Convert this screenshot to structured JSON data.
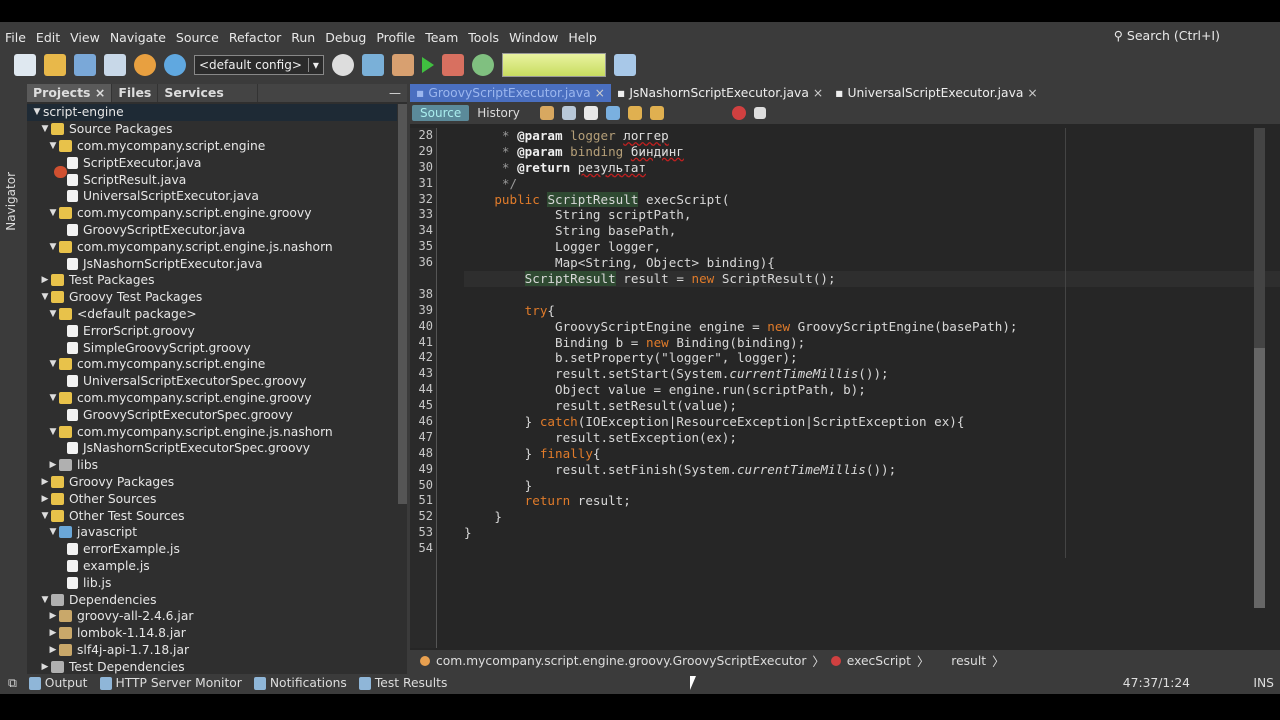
{
  "menu": [
    "File",
    "Edit",
    "View",
    "Navigate",
    "Source",
    "Refactor",
    "Run",
    "Debug",
    "Profile",
    "Team",
    "Tools",
    "Window",
    "Help"
  ],
  "search_placeholder": "Search (Ctrl+I)",
  "toolbar": {
    "config": "<default config>"
  },
  "navigator_label": "Navigator",
  "project_tabs": [
    "Projects",
    "Files",
    "Services"
  ],
  "tree": [
    {
      "label": "script-engine",
      "depth": 0,
      "arrow": "▼",
      "icon": "proj",
      "selected": true
    },
    {
      "label": "Source Packages",
      "depth": 1,
      "arrow": "▼",
      "icon": "pkg"
    },
    {
      "label": "com.mycompany.script.engine",
      "depth": 2,
      "arrow": "▼",
      "icon": "pkg"
    },
    {
      "label": "ScriptExecutor.java",
      "depth": 3,
      "arrow": "",
      "icon": "file"
    },
    {
      "label": "ScriptResult.java",
      "depth": 3,
      "arrow": "",
      "icon": "file"
    },
    {
      "label": "UniversalScriptExecutor.java",
      "depth": 3,
      "arrow": "",
      "icon": "file"
    },
    {
      "label": "com.mycompany.script.engine.groovy",
      "depth": 2,
      "arrow": "▼",
      "icon": "pkg"
    },
    {
      "label": "GroovyScriptExecutor.java",
      "depth": 3,
      "arrow": "",
      "icon": "file"
    },
    {
      "label": "com.mycompany.script.engine.js.nashorn",
      "depth": 2,
      "arrow": "▼",
      "icon": "pkg"
    },
    {
      "label": "JsNashornScriptExecutor.java",
      "depth": 3,
      "arrow": "",
      "icon": "file"
    },
    {
      "label": "Test Packages",
      "depth": 1,
      "arrow": "▶",
      "icon": "pkg"
    },
    {
      "label": "Groovy Test Packages",
      "depth": 1,
      "arrow": "▼",
      "icon": "pkg"
    },
    {
      "label": "<default package>",
      "depth": 2,
      "arrow": "▼",
      "icon": "pkg"
    },
    {
      "label": "ErrorScript.groovy",
      "depth": 3,
      "arrow": "",
      "icon": "file"
    },
    {
      "label": "SimpleGroovyScript.groovy",
      "depth": 3,
      "arrow": "",
      "icon": "file"
    },
    {
      "label": "com.mycompany.script.engine",
      "depth": 2,
      "arrow": "▼",
      "icon": "pkg"
    },
    {
      "label": "UniversalScriptExecutorSpec.groovy",
      "depth": 3,
      "arrow": "",
      "icon": "file"
    },
    {
      "label": "com.mycompany.script.engine.groovy",
      "depth": 2,
      "arrow": "▼",
      "icon": "pkg"
    },
    {
      "label": "GroovyScriptExecutorSpec.groovy",
      "depth": 3,
      "arrow": "",
      "icon": "file"
    },
    {
      "label": "com.mycompany.script.engine.js.nashorn",
      "depth": 2,
      "arrow": "▼",
      "icon": "pkg"
    },
    {
      "label": "JsNashornScriptExecutorSpec.groovy",
      "depth": 3,
      "arrow": "",
      "icon": "file"
    },
    {
      "label": "libs",
      "depth": 2,
      "arrow": "▶",
      "icon": "lib"
    },
    {
      "label": "Groovy Packages",
      "depth": 1,
      "arrow": "▶",
      "icon": "pkg"
    },
    {
      "label": "Other Sources",
      "depth": 1,
      "arrow": "▶",
      "icon": "pkg"
    },
    {
      "label": "Other Test Sources",
      "depth": 1,
      "arrow": "▼",
      "icon": "pkg"
    },
    {
      "label": "javascript",
      "depth": 2,
      "arrow": "▼",
      "icon": "folder"
    },
    {
      "label": "errorExample.js",
      "depth": 3,
      "arrow": "",
      "icon": "file"
    },
    {
      "label": "example.js",
      "depth": 3,
      "arrow": "",
      "icon": "file"
    },
    {
      "label": "lib.js",
      "depth": 3,
      "arrow": "",
      "icon": "file"
    },
    {
      "label": "Dependencies",
      "depth": 1,
      "arrow": "▼",
      "icon": "lib"
    },
    {
      "label": "groovy-all-2.4.6.jar",
      "depth": 2,
      "arrow": "▶",
      "icon": "jar"
    },
    {
      "label": "lombok-1.14.8.jar",
      "depth": 2,
      "arrow": "▶",
      "icon": "jar"
    },
    {
      "label": "slf4j-api-1.7.18.jar",
      "depth": 2,
      "arrow": "▶",
      "icon": "jar"
    },
    {
      "label": "Test Dependencies",
      "depth": 1,
      "arrow": "▶",
      "icon": "lib"
    }
  ],
  "editor_tabs": [
    {
      "label": "GroovyScriptExecutor.java",
      "active": true
    },
    {
      "label": "JsNashornScriptExecutor.java"
    },
    {
      "label": "UniversalScriptExecutor.java"
    }
  ],
  "editor_toolbar": {
    "source": "Source",
    "history": "History"
  },
  "code": [
    {
      "n": "28",
      "s": [
        [
          "     * ",
          "cm"
        ],
        [
          "@param",
          "tag"
        ],
        [
          " logger ",
          "prm"
        ],
        [
          "логгер",
          "ru"
        ]
      ]
    },
    {
      "n": "29",
      "s": [
        [
          "     * ",
          "cm"
        ],
        [
          "@param",
          "tag"
        ],
        [
          " binding ",
          "prm"
        ],
        [
          "биндинг",
          "ru"
        ]
      ]
    },
    {
      "n": "30",
      "s": [
        [
          "     * ",
          "cm"
        ],
        [
          "@return",
          "tag"
        ],
        [
          " ",
          ""
        ],
        [
          "результат",
          "ru"
        ]
      ]
    },
    {
      "n": "31",
      "s": [
        [
          "     */",
          "cm"
        ]
      ]
    },
    {
      "n": "32",
      "s": [
        [
          "    ",
          ""
        ],
        [
          "public",
          "kw"
        ],
        [
          " ",
          ""
        ],
        [
          "ScriptResult",
          "hl"
        ],
        [
          " execScript(",
          ""
        ]
      ]
    },
    {
      "n": "33",
      "s": [
        [
          "            String scriptPath,",
          ""
        ]
      ]
    },
    {
      "n": "34",
      "s": [
        [
          "            String basePath,",
          ""
        ]
      ]
    },
    {
      "n": "35",
      "s": [
        [
          "            Logger logger,",
          ""
        ]
      ]
    },
    {
      "n": "36",
      "s": [
        [
          "            Map<String, Object> binding){",
          ""
        ]
      ]
    },
    {
      "n": "",
      "cur": true,
      "s": [
        [
          "        ",
          ""
        ],
        [
          "ScriptResult",
          "hl"
        ],
        [
          " result = ",
          ""
        ],
        [
          "new",
          "kw"
        ],
        [
          " ScriptResult();",
          ""
        ]
      ]
    },
    {
      "n": "38",
      "s": []
    },
    {
      "n": "39",
      "s": [
        [
          "        ",
          ""
        ],
        [
          "try",
          "kw"
        ],
        [
          "{",
          ""
        ]
      ]
    },
    {
      "n": "40",
      "s": [
        [
          "            GroovyScriptEngine engine = ",
          ""
        ],
        [
          "new",
          "kw"
        ],
        [
          " GroovyScriptEngine(basePath);",
          ""
        ]
      ]
    },
    {
      "n": "41",
      "s": [
        [
          "            Binding b = ",
          ""
        ],
        [
          "new",
          "kw"
        ],
        [
          " Binding(binding);",
          ""
        ]
      ]
    },
    {
      "n": "42",
      "s": [
        [
          "            b.setProperty(\"logger\", logger);",
          ""
        ]
      ]
    },
    {
      "n": "43",
      "s": [
        [
          "            result.setStart(System.",
          ""
        ],
        [
          "currentTimeMillis",
          "st"
        ],
        [
          "());",
          ""
        ]
      ]
    },
    {
      "n": "44",
      "s": [
        [
          "            Object value = engine.run(scriptPath, b);",
          ""
        ]
      ]
    },
    {
      "n": "45",
      "s": [
        [
          "            result.setResult(value);",
          ""
        ]
      ]
    },
    {
      "n": "46",
      "s": [
        [
          "        } ",
          ""
        ],
        [
          "catch",
          "kw"
        ],
        [
          "(IOException|ResourceException|ScriptException ex){",
          ""
        ]
      ]
    },
    {
      "n": "47",
      "s": [
        [
          "            result.setException(ex);",
          ""
        ]
      ]
    },
    {
      "n": "48",
      "s": [
        [
          "        } ",
          ""
        ],
        [
          "finally",
          "kw"
        ],
        [
          "{",
          ""
        ]
      ]
    },
    {
      "n": "49",
      "s": [
        [
          "            result.setFinish(System.",
          ""
        ],
        [
          "currentTimeMillis",
          "st"
        ],
        [
          "());",
          ""
        ]
      ]
    },
    {
      "n": "50",
      "s": [
        [
          "        }",
          ""
        ]
      ]
    },
    {
      "n": "51",
      "s": [
        [
          "        ",
          ""
        ],
        [
          "return",
          "kw"
        ],
        [
          " result;",
          ""
        ]
      ]
    },
    {
      "n": "52",
      "s": [
        [
          "    }",
          ""
        ]
      ]
    },
    {
      "n": "53",
      "s": [
        [
          "}",
          ""
        ]
      ]
    },
    {
      "n": "54",
      "s": []
    }
  ],
  "breadcrumb": [
    "com.mycompany.script.engine.groovy.GroovyScriptExecutor",
    "execScript",
    "result"
  ],
  "bottom_tabs": [
    "Output",
    "HTTP Server Monitor",
    "Notifications",
    "Test Results"
  ],
  "status": {
    "position": "47:37/1:24",
    "mode": "INS"
  }
}
